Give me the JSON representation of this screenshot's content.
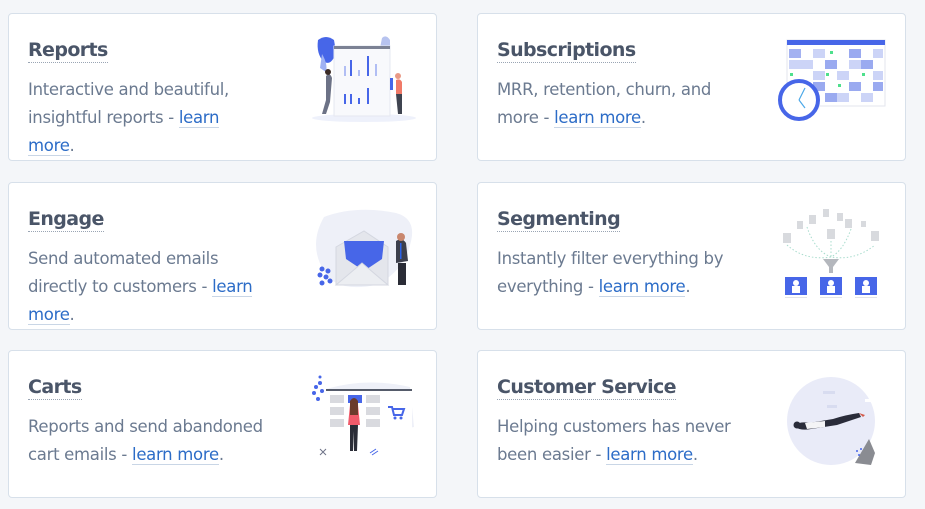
{
  "cards": [
    {
      "title": "Reports",
      "description": "Interactive and beautiful, insightful reports - ",
      "link": "learn more",
      "suffix": ".",
      "illustration": "reports-chart-illustration"
    },
    {
      "title": "Subscriptions",
      "description": "MRR, retention, churn, and more - ",
      "link": "learn more",
      "suffix": ".",
      "illustration": "calendar-clock-illustration"
    },
    {
      "title": "Engage",
      "description": "Send automated emails directly to customers - ",
      "link": "learn more",
      "suffix": ".",
      "illustration": "envelope-illustration"
    },
    {
      "title": "Segmenting",
      "description": "Instantly filter everything by everything - ",
      "link": "learn more",
      "suffix": ".",
      "illustration": "funnel-segmenting-illustration"
    },
    {
      "title": "Carts",
      "description": "Reports and send abandoned cart emails - ",
      "link": "learn more",
      "suffix": ".",
      "illustration": "shopping-cart-illustration"
    },
    {
      "title": "Customer Service",
      "description": "Helping customers has never been easier - ",
      "link": "learn more",
      "suffix": ".",
      "illustration": "flying-person-illustration"
    }
  ],
  "colors": {
    "accent": "#4766e8",
    "link": "#2c6cc7",
    "title": "#4a5568",
    "text": "#6b7a90"
  }
}
